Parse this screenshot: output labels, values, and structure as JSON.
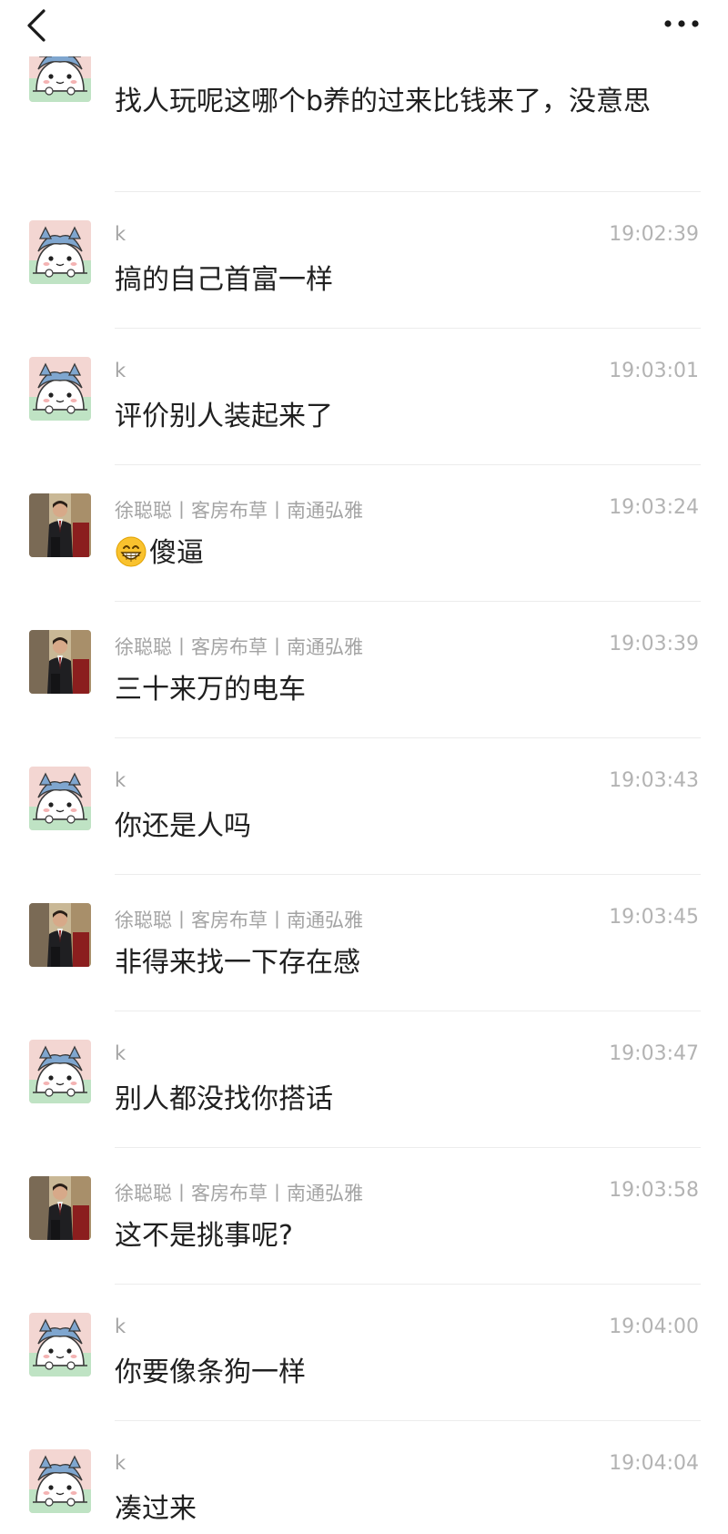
{
  "header": {
    "back_icon": "chevron-left-icon",
    "more_icon": "more-dots-icon"
  },
  "colors": {
    "time": "#b3b3b3",
    "sender": "#a3a3a3",
    "separator": "#ececec"
  },
  "messages": [
    {
      "sender": "",
      "time": "",
      "text": "找人玩呢这哪个b养的过来比钱来了，没意思",
      "avatar": "cat"
    },
    {
      "sender": "k",
      "time": "19:02:39",
      "text": "搞的自己首富一样",
      "avatar": "cat"
    },
    {
      "sender": "k",
      "time": "19:03:01",
      "text": "评价别人装起来了",
      "avatar": "cat"
    },
    {
      "sender": "徐聪聪丨客房布草丨南通弘雅",
      "time": "19:03:24",
      "text": "傻逼",
      "avatar": "man",
      "emoji": "grinning-emoji"
    },
    {
      "sender": "徐聪聪丨客房布草丨南通弘雅",
      "time": "19:03:39",
      "text": "三十来万的电车",
      "avatar": "man"
    },
    {
      "sender": "k",
      "time": "19:03:43",
      "text": "你还是人吗",
      "avatar": "cat"
    },
    {
      "sender": "徐聪聪丨客房布草丨南通弘雅",
      "time": "19:03:45",
      "text": "非得来找一下存在感",
      "avatar": "man"
    },
    {
      "sender": "k",
      "time": "19:03:47",
      "text": "别人都没找你搭话",
      "avatar": "cat"
    },
    {
      "sender": "徐聪聪丨客房布草丨南通弘雅",
      "time": "19:03:58",
      "text": "这不是挑事呢?",
      "avatar": "man"
    },
    {
      "sender": "k",
      "time": "19:04:00",
      "text": "你要像条狗一样",
      "avatar": "cat"
    },
    {
      "sender": "k",
      "time": "19:04:04",
      "text": "凑过来",
      "avatar": "cat"
    }
  ]
}
